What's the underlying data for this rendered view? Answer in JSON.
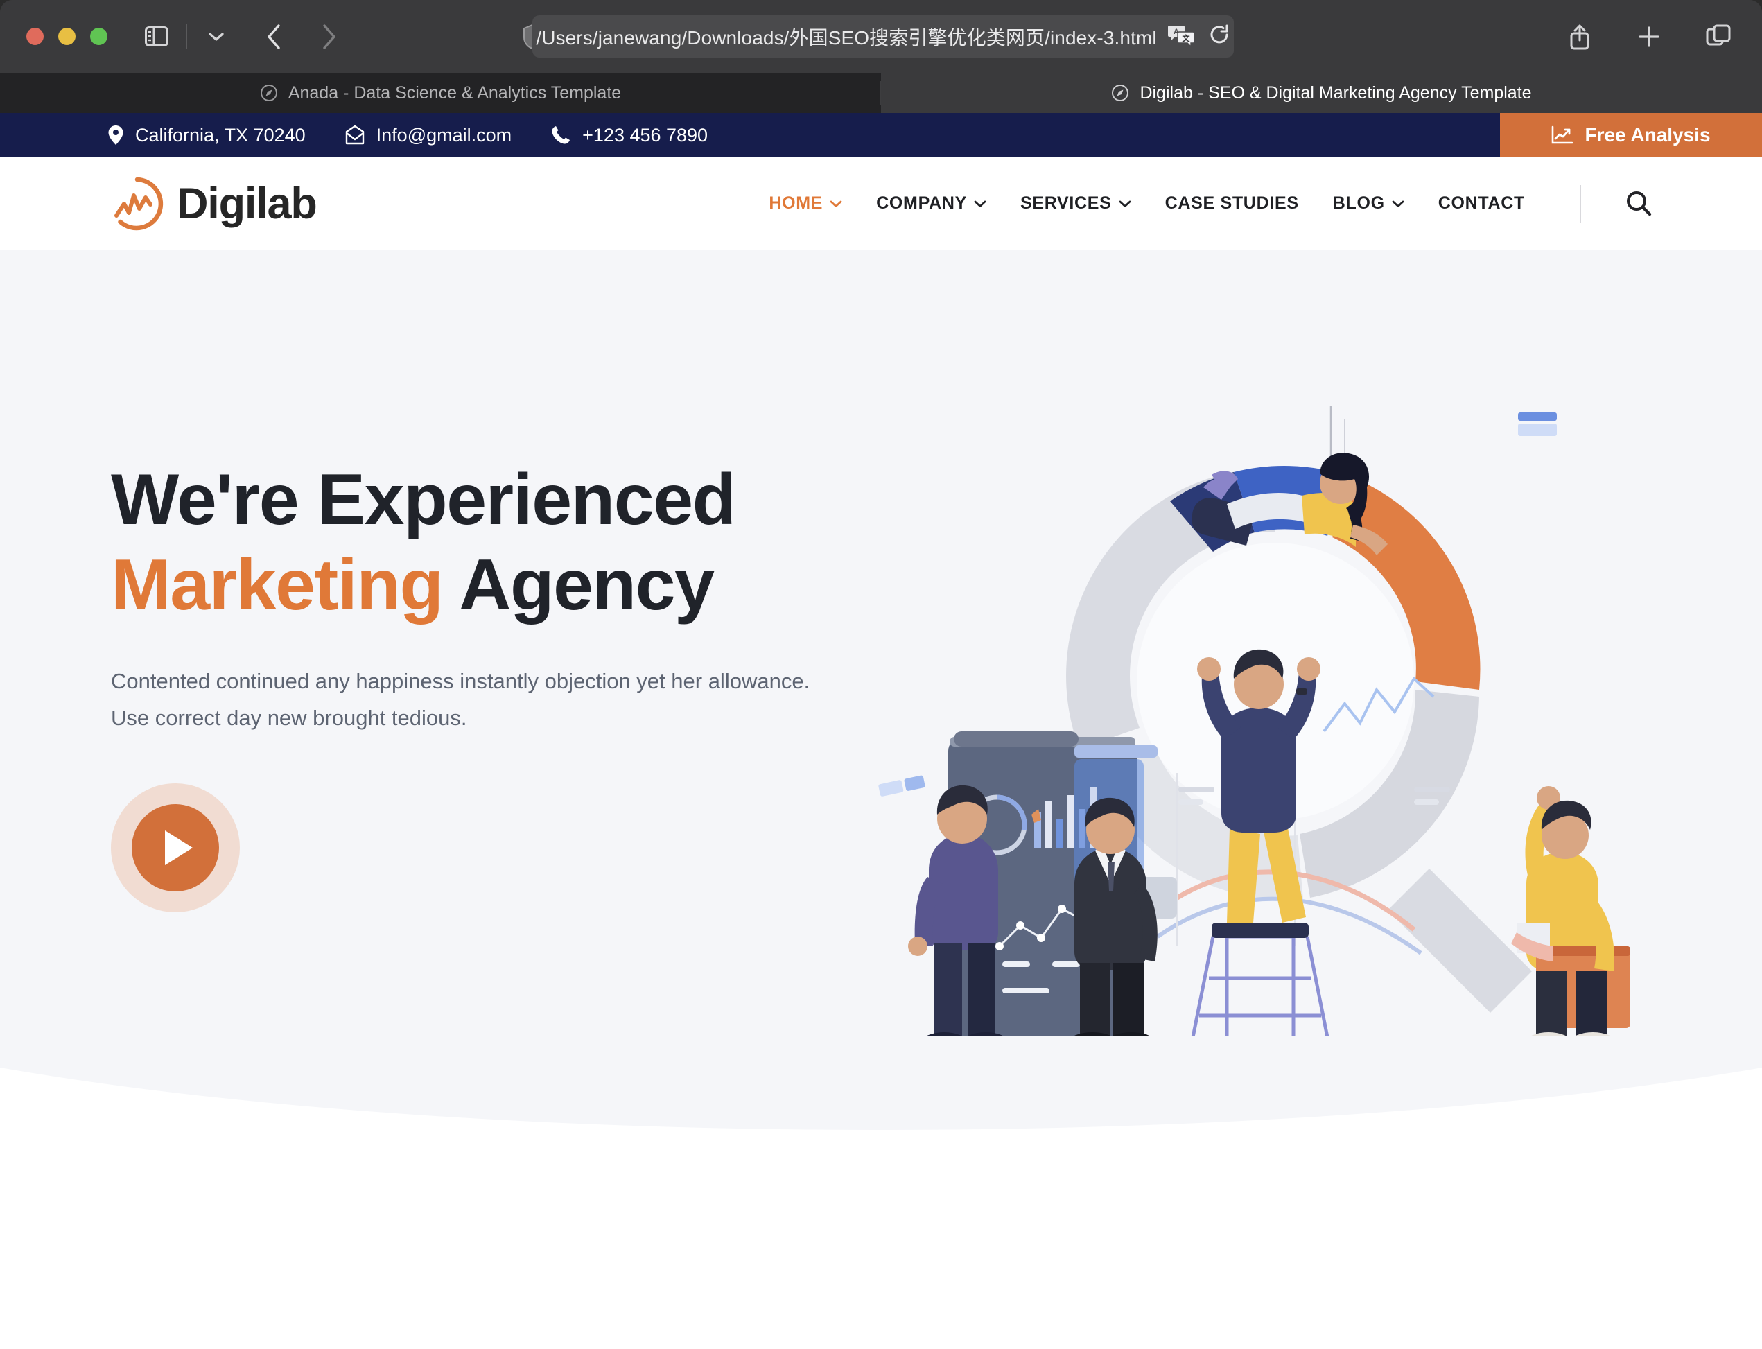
{
  "browser": {
    "url": "/Users/janewang/Downloads/外国SEO搜索引擎优化类网页/index-3.html",
    "icons": {
      "sidebar": "sidebar-toggle-icon",
      "chevron": "chevron-down-icon",
      "back": "back-arrow-icon",
      "forward": "forward-arrow-icon",
      "shield": "shield-privacy-icon",
      "translate": "translate-icon",
      "reload": "reload-icon",
      "share": "share-icon",
      "newtab": "plus-icon",
      "tabs": "tab-overview-icon"
    },
    "tabs": [
      {
        "title": "Anada - Data Science & Analytics Template",
        "active": false
      },
      {
        "title": "Digilab - SEO & Digital Marketing Agency Template",
        "active": true
      }
    ]
  },
  "topbar": {
    "address": "California, TX 70240",
    "email": "Info@gmail.com",
    "phone": "+123 456 7890",
    "cta_label": "Free Analysis",
    "bg_color": "#161d4c",
    "cta_color": "#d2703a"
  },
  "header": {
    "brand": "Digilab",
    "nav": [
      {
        "label": "HOME",
        "caret": true,
        "active": true
      },
      {
        "label": "COMPANY",
        "caret": true,
        "active": false
      },
      {
        "label": "SERVICES",
        "caret": true,
        "active": false
      },
      {
        "label": "CASE STUDIES",
        "caret": false,
        "active": false
      },
      {
        "label": "BLOG",
        "caret": true,
        "active": false
      },
      {
        "label": "CONTACT",
        "caret": false,
        "active": false
      }
    ],
    "accent_color": "#e07938"
  },
  "hero": {
    "heading_line1": "We're Experienced",
    "heading_accent": "Marketing",
    "heading_line2_rest": " Agency",
    "paragraph": "Contented continued any happiness instantly objection yet her allowance. Use correct day new brought tedious.",
    "play_label": "play-video",
    "bg_color": "#f5f6f9"
  }
}
